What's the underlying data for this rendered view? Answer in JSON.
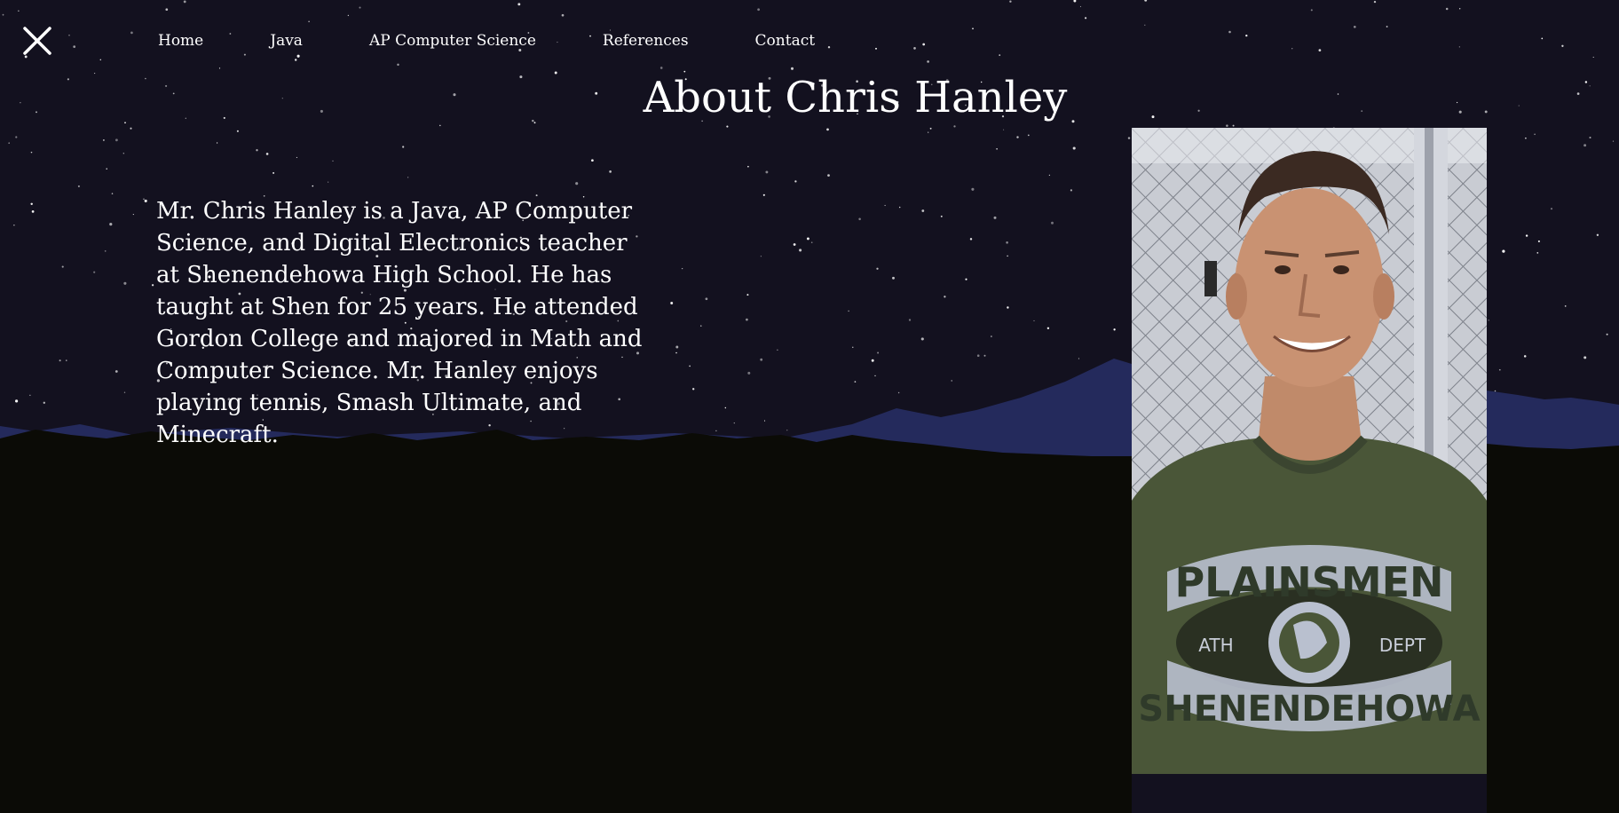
{
  "nav": {
    "close_icon": "close-icon",
    "items": [
      {
        "label": "Home"
      },
      {
        "label": "Java"
      },
      {
        "label": "AP Computer Science"
      },
      {
        "label": "References"
      },
      {
        "label": "Contact"
      }
    ]
  },
  "main": {
    "title": "About Chris Hanley",
    "bio": "Mr. Chris Hanley is a Java, AP Computer Science, and Digital Electronics teacher at Shenendehowa High School. He has taught at Shen for 25 years. He attended Gordon College and majored in Math and Computer Science. Mr. Hanley enjoys playing tennis, Smash Ultimate, and Minecraft."
  },
  "photo": {
    "shirt_line1": "PLAINSMEN",
    "shirt_left": "ATH",
    "shirt_right": "DEPT",
    "shirt_line2": "SHENENDEHOWA"
  },
  "colors": {
    "sky": "#13111f",
    "mountains_far": "#242a5c",
    "ground": "#0b0b06",
    "text": "#ffffff"
  }
}
